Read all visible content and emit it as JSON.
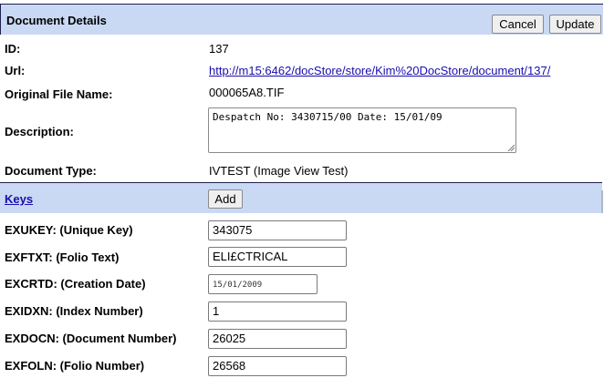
{
  "header": {
    "title": "Document Details",
    "cancel_label": "Cancel",
    "update_label": "Update"
  },
  "fields": {
    "id": {
      "label": "ID:",
      "value": "137"
    },
    "url": {
      "label": "Url:",
      "value": "http://m15:6462/docStore/store/Kim%20DocStore/document/137/"
    },
    "file_name": {
      "label": "Original File Name:",
      "value": "000065A8.TIF"
    },
    "description": {
      "label": "Description:",
      "value": "Despatch No: 3430715/00 Date: 15/01/09"
    },
    "doc_type": {
      "label": "Document Type:",
      "value": "IVTEST (Image View Test)"
    }
  },
  "keys": {
    "title": "Keys",
    "add_label": "Add",
    "items": [
      {
        "label": "EXUKEY: (Unique Key)",
        "value": "343075"
      },
      {
        "label": "EXFTXT: (Folio Text)",
        "value": "ELI£CTRICAL"
      },
      {
        "label": "EXCRTD: (Creation Date)",
        "value": "15/01/2009"
      },
      {
        "label": "EXIDXN: (Index Number)",
        "value": "1"
      },
      {
        "label": "EXDOCN: (Document Number)",
        "value": "26025"
      },
      {
        "label": "EXFOLN: (Folio Number)",
        "value": "26568"
      }
    ]
  },
  "colors": {
    "header_bg": "#c9d9f4",
    "header_border": "#1f1f4f",
    "link": "#1a0dab"
  }
}
